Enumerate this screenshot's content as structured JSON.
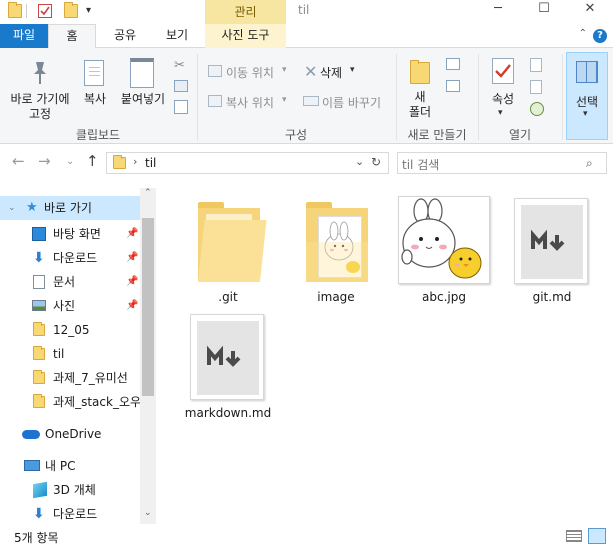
{
  "window": {
    "title": "til",
    "context_tab_header": "관리",
    "minimize": "─",
    "maximize": "☐",
    "close": "✕"
  },
  "tabs": {
    "file": "파일",
    "home": "홈",
    "share": "공유",
    "view": "보기",
    "picture_tools": "사진 도구"
  },
  "ribbon": {
    "clipboard": {
      "pin_quick_access": "바로 가기에\n고정",
      "copy": "복사",
      "paste": "붙여넣기",
      "group_label": "클립보드"
    },
    "organize": {
      "move_to": "이동 위치",
      "copy_to": "복사 위치",
      "delete": "삭제",
      "rename": "이름 바꾸기",
      "group_label": "구성"
    },
    "new": {
      "new_folder": "새\n폴더",
      "group_label": "새로 만들기"
    },
    "open": {
      "properties": "속성",
      "group_label": "열기"
    },
    "select": {
      "select": "선택"
    }
  },
  "address": {
    "current": "til",
    "search_placeholder": "til 검색"
  },
  "nav": {
    "items": [
      {
        "label": "바로 가기",
        "icon": "star-icon",
        "selected": true,
        "pinned": false
      },
      {
        "label": "바탕 화면",
        "icon": "desktop-icon",
        "pinned": true
      },
      {
        "label": "다운로드",
        "icon": "download-icon",
        "pinned": true
      },
      {
        "label": "문서",
        "icon": "document-icon",
        "pinned": true
      },
      {
        "label": "사진",
        "icon": "picture-icon",
        "pinned": true
      },
      {
        "label": "12_05",
        "icon": "folder-icon",
        "pinned": false
      },
      {
        "label": "til",
        "icon": "folder-icon",
        "pinned": false
      },
      {
        "label": "과제_7_유미선",
        "icon": "folder-icon",
        "pinned": false
      },
      {
        "label": "과제_stack_오우",
        "icon": "folder-icon",
        "pinned": false
      },
      {
        "label": "OneDrive",
        "icon": "cloud-icon",
        "pinned": false
      },
      {
        "label": "내 PC",
        "icon": "pc-icon",
        "pinned": false
      },
      {
        "label": "3D 개체",
        "icon": "cube-icon",
        "pinned": false
      },
      {
        "label": "다운로드",
        "icon": "download-icon",
        "pinned": false
      }
    ]
  },
  "files": [
    {
      "name": ".git",
      "type": "folder"
    },
    {
      "name": "image",
      "type": "folder-image"
    },
    {
      "name": "abc.jpg",
      "type": "image"
    },
    {
      "name": "git.md",
      "type": "markdown"
    },
    {
      "name": "markdown.md",
      "type": "markdown"
    }
  ],
  "status": {
    "count": "5개 항목"
  },
  "colors": {
    "accent": "#1979ca",
    "context_tab": "#f7e5a2",
    "folder": "#f8d775",
    "selected_nav": "#cce8ff"
  }
}
